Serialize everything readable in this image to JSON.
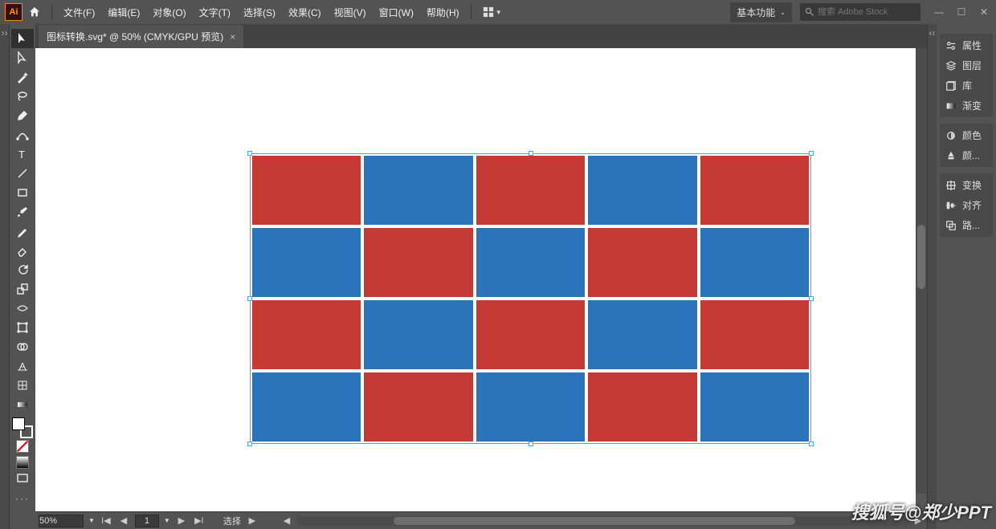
{
  "app_logo": "Ai",
  "menu": {
    "file": "文件(F)",
    "edit": "编辑(E)",
    "object": "对象(O)",
    "type": "文字(T)",
    "select": "选择(S)",
    "effect": "效果(C)",
    "view": "视图(V)",
    "window": "窗口(W)",
    "help": "帮助(H)"
  },
  "workspace": {
    "label": "基本功能"
  },
  "search": {
    "placeholder": "搜索 Adobe Stock"
  },
  "tab": {
    "title": "图标转换.svg* @ 50% (CMYK/GPU 预览)",
    "close": "×"
  },
  "statusbar": {
    "zoom": "50%",
    "artboard": "1",
    "tool_label": "选择"
  },
  "panels": {
    "properties": "属性",
    "layers": "图层",
    "libraries": "库",
    "gradient": "渐变",
    "color": "颜色",
    "color_short": "颜...",
    "transform": "变换",
    "align": "对齐",
    "pathfinder": "路..."
  },
  "canvas": {
    "pattern": [
      [
        "r",
        "b",
        "r",
        "b",
        "r"
      ],
      [
        "b",
        "r",
        "b",
        "r",
        "b"
      ],
      [
        "r",
        "b",
        "r",
        "b",
        "r"
      ],
      [
        "b",
        "r",
        "b",
        "r",
        "b"
      ]
    ]
  },
  "watermark": "搜狐号@郑少PPT"
}
